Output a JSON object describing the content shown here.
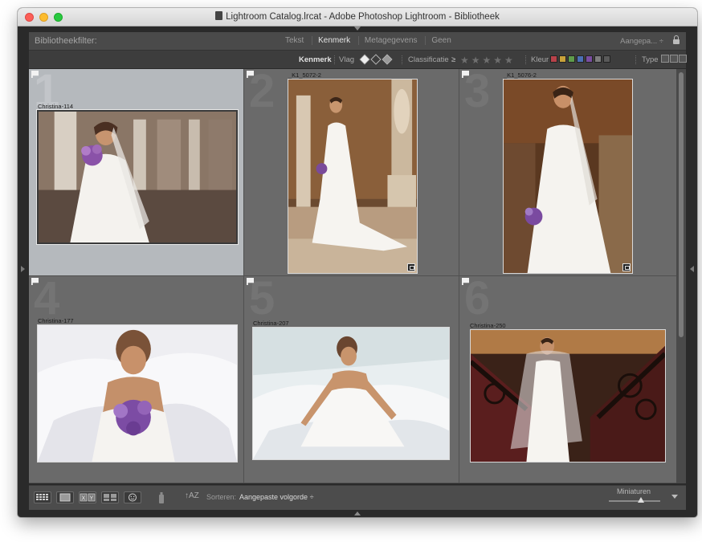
{
  "window": {
    "title": "Lightroom Catalog.lrcat - Adobe Photoshop Lightroom - Bibliotheek"
  },
  "filter_bar": {
    "label": "Bibliotheekfilter:",
    "tabs": [
      {
        "label": "Tekst",
        "active": false
      },
      {
        "label": "Kenmerk",
        "active": true
      },
      {
        "label": "Metagegevens",
        "active": false
      },
      {
        "label": "Geen",
        "active": false
      }
    ],
    "preset": "Aangepa...",
    "preset_arrow": "÷",
    "lock_icon": "lock-icon"
  },
  "attribute_bar": {
    "kenmerk": "Kenmerk",
    "vlag": "Vlag",
    "classificatie": "Classificatie",
    "operator": "≥",
    "stars": "★★★★★",
    "kleur": "Kleur",
    "type": "Type",
    "colors": [
      "#b8424a",
      "#c9a23a",
      "#5f9c4b",
      "#4b6fb4",
      "#7a4ea0",
      "#7d7d7d",
      "#5a5a5a"
    ]
  },
  "grid": {
    "cells": [
      {
        "num": "1",
        "name": "Christina-114",
        "selected": true,
        "badge": false
      },
      {
        "num": "2",
        "name": "_K1_5072-2",
        "selected": false,
        "badge": true
      },
      {
        "num": "3",
        "name": "_K1_5076-2",
        "selected": false,
        "badge": true
      },
      {
        "num": "4",
        "name": "Christina-177",
        "selected": false,
        "badge": false
      },
      {
        "num": "5",
        "name": "Christina-207",
        "selected": false,
        "badge": false
      },
      {
        "num": "6",
        "name": "Christina-250",
        "selected": false,
        "badge": false
      }
    ]
  },
  "toolbar": {
    "sort_icon": "↑AZ",
    "sort_label": "Sorteren:",
    "sort_value": "Aangepaste volgorde ÷",
    "thumbnails_label": "Miniaturen",
    "xy_label": "X|Y"
  }
}
